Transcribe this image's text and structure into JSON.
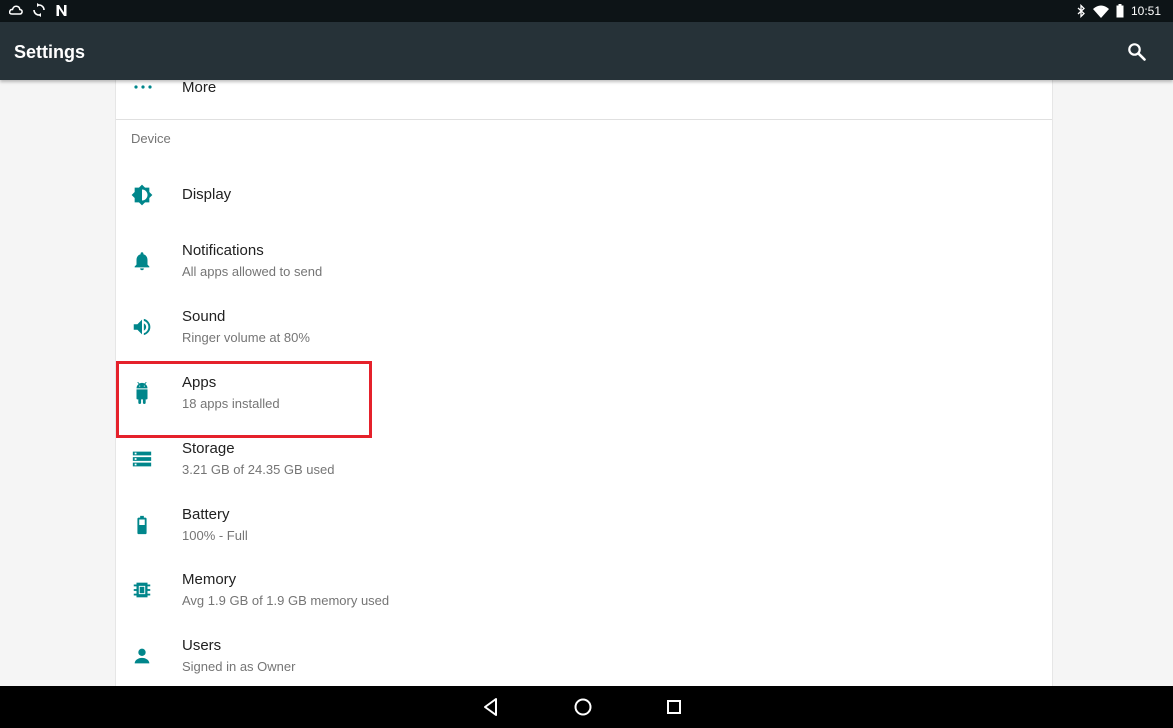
{
  "status_bar": {
    "time": "10:51",
    "left_icons": [
      "cloud-icon",
      "sync-icon",
      "n-notification-icon"
    ],
    "right_icons": [
      "bluetooth-icon",
      "wifi-icon",
      "battery-icon"
    ]
  },
  "app_bar": {
    "title": "Settings",
    "search_icon": "search-icon",
    "color": "#263238"
  },
  "settings": {
    "more_label": "More",
    "category_device": "Device",
    "items": [
      {
        "icon": "display-brightness-icon",
        "title": "Display",
        "summary": ""
      },
      {
        "icon": "bell-icon",
        "title": "Notifications",
        "summary": "All apps allowed to send"
      },
      {
        "icon": "volume-icon",
        "title": "Sound",
        "summary": "Ringer volume at 80%"
      },
      {
        "icon": "android-icon",
        "title": "Apps",
        "summary": "18 apps installed"
      },
      {
        "icon": "storage-icon",
        "title": "Storage",
        "summary": "3.21 GB of 24.35 GB used"
      },
      {
        "icon": "battery-icon",
        "title": "Battery",
        "summary": "100% - Full"
      },
      {
        "icon": "memory-chip-icon",
        "title": "Memory",
        "summary": "Avg 1.9 GB of 1.9 GB memory used"
      },
      {
        "icon": "person-icon",
        "title": "Users",
        "summary": "Signed in as Owner"
      }
    ]
  },
  "highlight": {
    "target": "Apps",
    "color": "#e5212b"
  },
  "accent_color": "#00868b",
  "nav_bar": {
    "buttons": [
      "back-icon",
      "home-icon",
      "recents-icon"
    ]
  }
}
